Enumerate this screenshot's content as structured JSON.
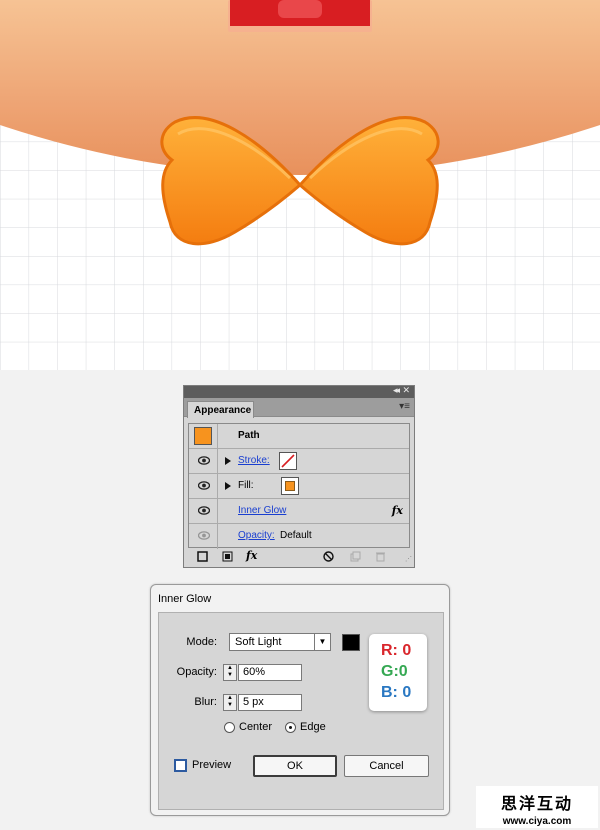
{
  "appearance_panel": {
    "tab_label": "Appearance",
    "collapse_glyph": "◂◂",
    "close_glyph": "✕",
    "menu_glyph": "▾≡",
    "rows": {
      "path": {
        "label": "Path",
        "swatch_color": "#f7931e"
      },
      "stroke": {
        "label": "Stroke:",
        "swatch": "none"
      },
      "fill": {
        "label": "Fill:",
        "swatch_color": "#f7931e"
      },
      "inner_glow": {
        "label": "Inner Glow",
        "fx_glyph": "fx"
      },
      "opacity": {
        "label": "Opacity:",
        "value": "Default"
      }
    },
    "footer": {
      "new_stroke_icon": "new-stroke-icon",
      "new_fill_icon": "new-fill-icon",
      "fx_glyph": "fx",
      "clear_icon": "clear-appearance-icon",
      "duplicate_icon": "duplicate-item-icon",
      "delete_icon": "delete-item-icon"
    }
  },
  "inner_glow_dialog": {
    "title": "Inner Glow",
    "mode_label": "Mode:",
    "mode_value": "Soft Light",
    "mode_color": "#000000",
    "opacity_label": "Opacity:",
    "opacity_value": "60%",
    "blur_label": "Blur:",
    "blur_value": "5 px",
    "center_label": "Center",
    "edge_label": "Edge",
    "selected_source": "Edge",
    "preview_label": "Preview",
    "preview_checked": false,
    "ok_label": "OK",
    "cancel_label": "Cancel"
  },
  "rgb_callout": {
    "r": "R: 0",
    "g": "G:0",
    "b": "B: 0",
    "r_color": "#d9262c",
    "g_color": "#35a853",
    "b_color": "#2a78c2"
  },
  "watermark": {
    "chinese": "思洋互动",
    "url": "www.ciya.com"
  },
  "colors": {
    "bow_orange": "#f7931e",
    "face_peach": "#f0a870",
    "link_blue": "#1a3fd0"
  }
}
